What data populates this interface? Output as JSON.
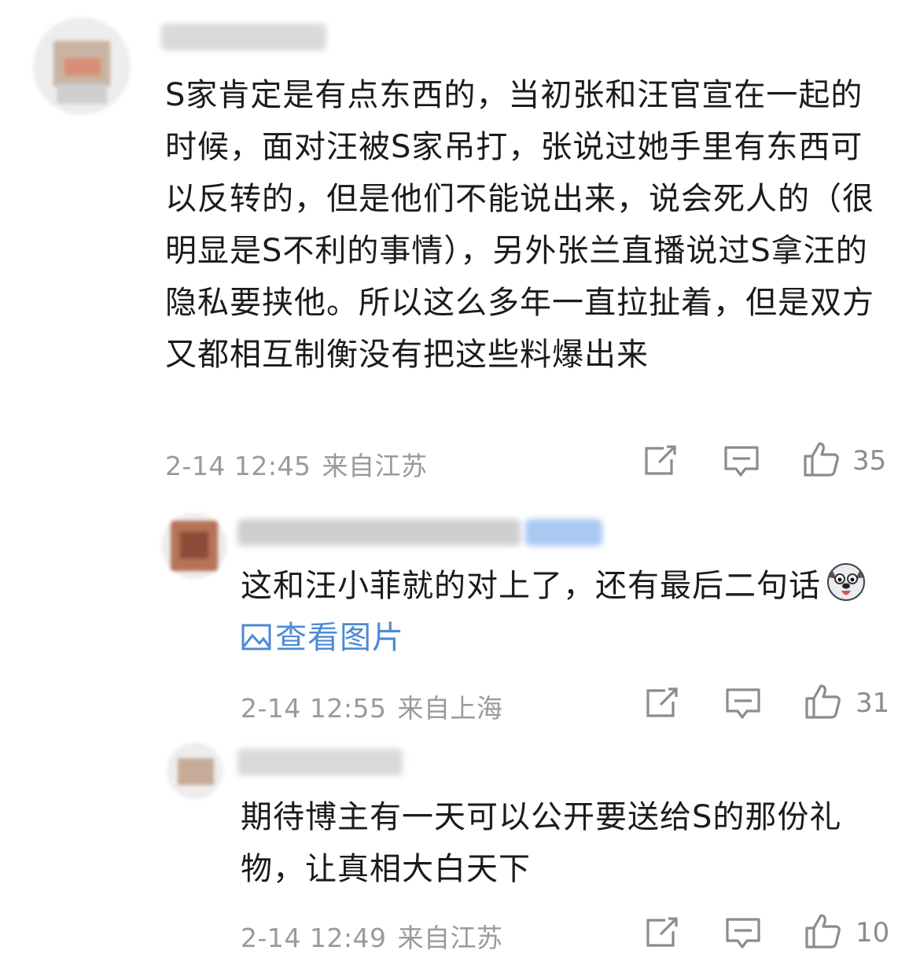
{
  "comments": [
    {
      "text": "S家肯定是有点东西的，当初张和汪官宣在一起的时候，面对汪被S家吊打，张说过她手里有东西可以反转的，但是他们不能说出来，说会死人的（很明显是S不利的事情），另外张兰直播说过S拿汪的隐私要挟他。所以这么多年一直拉扯着，但是双方又都相互制衡没有把这些料爆出来",
      "time": "2-14 12:45",
      "location": "来自江苏",
      "likes": "35"
    },
    {
      "text": "这和汪小菲就的对上了，还有最后二句话",
      "view_image": "查看图片",
      "time": "2-14 12:55",
      "location": "来自上海",
      "likes": "31"
    },
    {
      "text": "期待博主有一天可以公开要送给S的那份礼物，让真相大白天下",
      "time": "2-14 12:49",
      "location": "来自江苏",
      "likes": "10"
    }
  ],
  "icons": {
    "share": "share-icon",
    "reply": "comment-icon",
    "like": "thumbs-up-icon",
    "image": "image-icon",
    "emoji": "husky-emoji-icon"
  },
  "colors": {
    "meta_text": "#9a9a9a",
    "link": "#4e8ad6",
    "body_text": "#1b1b1b"
  }
}
